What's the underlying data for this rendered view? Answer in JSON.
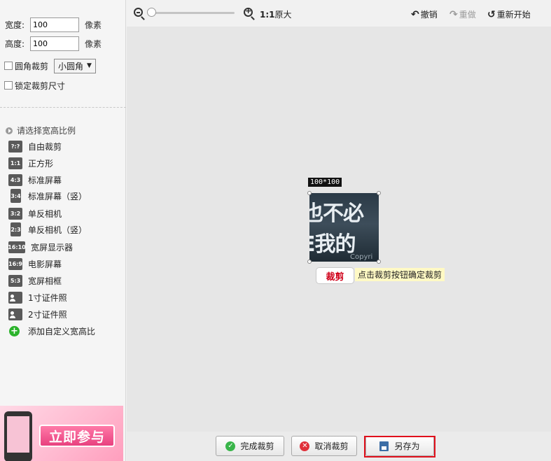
{
  "left_panel": {
    "width_label": "宽度:",
    "width_value": "100",
    "height_label": "高度:",
    "height_value": "100",
    "unit": "像素",
    "round_crop_label": "圆角裁剪",
    "round_select_value": "小圆角",
    "lock_size_label": "锁定裁剪尺寸",
    "ratio_header": "请选择宽高比例",
    "ratios": [
      {
        "icon": "?:?",
        "label": "自由裁剪"
      },
      {
        "icon": "1:1",
        "label": "正方形"
      },
      {
        "icon": "4:3",
        "label": "标准屏幕"
      },
      {
        "icon": "3:4",
        "label": "标准屏幕（竖）"
      },
      {
        "icon": "3:2",
        "label": "单反相机"
      },
      {
        "icon": "2:3",
        "label": "单反相机（竖）"
      },
      {
        "icon": "16:10",
        "label": "宽屏显示器"
      },
      {
        "icon": "16:9",
        "label": "电影屏幕"
      },
      {
        "icon": "5:3",
        "label": "宽屏相框"
      },
      {
        "icon": "id-photo-icon",
        "label": "1寸证件照"
      },
      {
        "icon": "id-photo-icon",
        "label": "2寸证件照"
      },
      {
        "icon": "add-icon",
        "label": "添加自定义宽高比"
      }
    ],
    "ad_button": "立即参与"
  },
  "toolbar": {
    "ratio_bold": "1:1",
    "ratio_text": "原大",
    "undo": "撤销",
    "redo": "重做",
    "reset": "重新开始"
  },
  "canvas": {
    "size_tag": "100*100",
    "image_text_line1": "也不必",
    "image_text_line2": "E我的",
    "image_text_line3": "Copyri",
    "crop_button": "裁剪",
    "hint": "点击裁剪按钮确定裁剪"
  },
  "bottom": {
    "finish": "完成裁剪",
    "cancel": "取消裁剪",
    "save_as": "另存为"
  },
  "colors": {
    "highlight_border": "#e0101c",
    "crop_button_text": "#d0021b",
    "hint_bg": "#fff9c4"
  }
}
